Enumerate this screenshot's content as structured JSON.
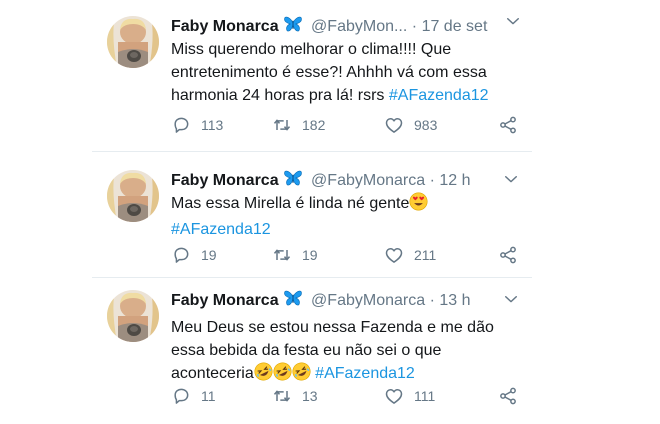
{
  "tweets": [
    {
      "author": "Faby Monarca",
      "badge_icon": "butterfly-icon",
      "handle": "@FabyMon...",
      "separator": "·",
      "time": "17 de set",
      "text": "Miss querendo melhorar o clima!!!! Que entretenimento é esse?! Ahhhh vá com essa harmonia 24 horas pra lá! rsrs",
      "hashtag": "#AFazenda12",
      "replies": "113",
      "retweets": "182",
      "likes": "983"
    },
    {
      "author": "Faby Monarca",
      "badge_icon": "butterfly-icon",
      "handle": "@FabyMonarca",
      "separator": "·",
      "time": "12 h",
      "text": "Mas essa Mirella é linda né gente",
      "emoji": "heart-eyes-emoji",
      "hashtag": "#AFazenda12",
      "replies": "19",
      "retweets": "19",
      "likes": "211"
    },
    {
      "author": "Faby Monarca",
      "badge_icon": "butterfly-icon",
      "handle": "@FabyMonarca",
      "separator": "·",
      "time": "13 h",
      "text": "Meu Deus se estou nessa Fazenda e me dão essa bebida da festa eu não sei o que aconteceria",
      "emoji": "rofl-emoji x3",
      "hashtag": "#AFazenda12",
      "replies": "11",
      "retweets": "13",
      "likes": "111"
    }
  ],
  "colors": {
    "link": "#1b95e0",
    "muted": "#657786",
    "text": "#14171a",
    "badge": "#1d9bf0",
    "divider": "#e6ecf0"
  }
}
